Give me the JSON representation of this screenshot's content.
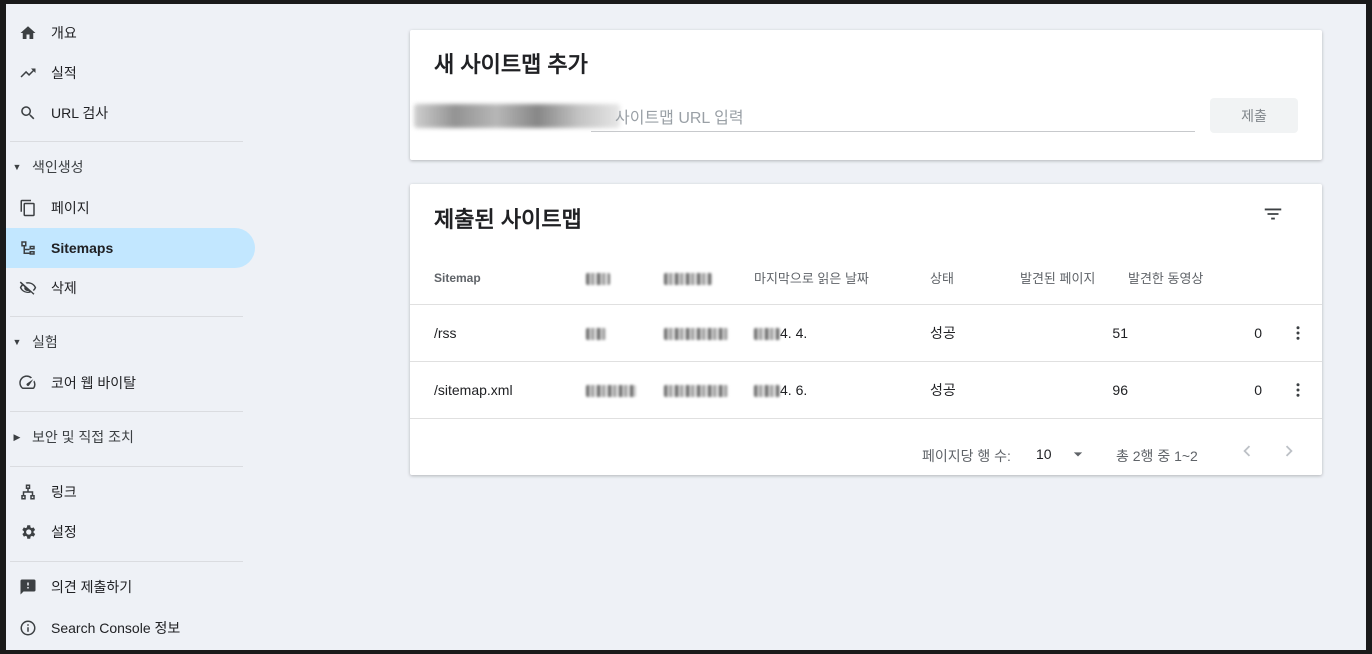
{
  "sidebar": {
    "items": [
      {
        "label": "개요",
        "icon": "home-icon"
      },
      {
        "label": "실적",
        "icon": "trending-up-icon"
      },
      {
        "label": "URL 검사",
        "icon": "search-icon"
      }
    ],
    "indexing": {
      "label": "색인생성",
      "items": [
        {
          "label": "페이지",
          "icon": "copy-pages-icon"
        },
        {
          "label": "Sitemaps",
          "icon": "sitemap-icon",
          "active": true
        },
        {
          "label": "삭제",
          "icon": "visibility-off-icon"
        }
      ]
    },
    "experience": {
      "label": "실험",
      "items": [
        {
          "label": "코어 웹 바이탈",
          "icon": "speed-gauge-icon"
        }
      ]
    },
    "security": {
      "label": "보안 및 직접 조치"
    },
    "bottom_items": [
      {
        "label": "링크",
        "icon": "links-icon"
      },
      {
        "label": "설정",
        "icon": "settings-gear-icon"
      }
    ],
    "footer_items": [
      {
        "label": "의견 제출하기",
        "icon": "feedback-icon"
      },
      {
        "label": "Search Console 정보",
        "icon": "info-icon"
      }
    ]
  },
  "add_card": {
    "title": "새 사이트맵 추가",
    "input_placeholder": "사이트맵 URL 입력",
    "submit_label": "제출"
  },
  "submitted_card": {
    "title": "제출된 사이트맵",
    "columns": {
      "sitemap": "Sitemap",
      "last_read": "마지막으로 읽은 날짜",
      "status": "상태",
      "pages": "발견된 페이지",
      "videos": "발견한 동영상"
    },
    "rows": [
      {
        "sitemap": "/rss",
        "last_read": "4. 4.",
        "status": "성공",
        "pages": "51",
        "videos": "0"
      },
      {
        "sitemap": "/sitemap.xml",
        "last_read": "4. 6.",
        "status": "성공",
        "pages": "96",
        "videos": "0"
      }
    ],
    "pager": {
      "rows_per_page_label": "페이지당 행 수:",
      "rows_per_page_value": "10",
      "range_text": "총 2행 중 1~2"
    }
  },
  "colors": {
    "active_nav_bg": "#c2e7ff",
    "status_success": "#188038",
    "page_bg": "#eef1f6"
  }
}
